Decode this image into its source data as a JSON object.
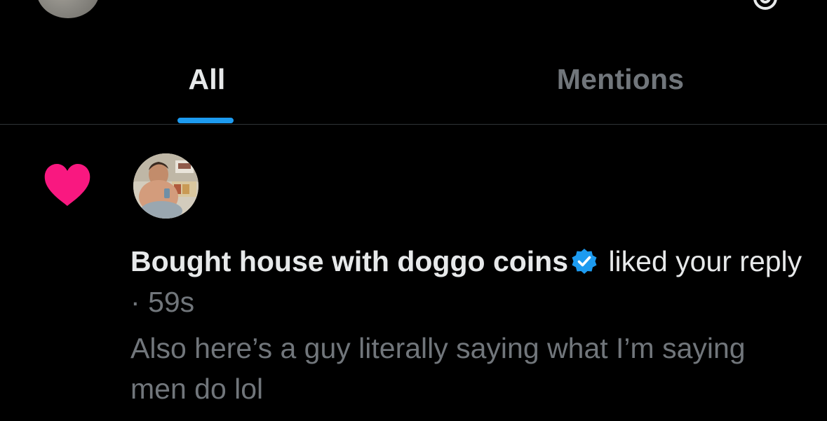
{
  "tabs": [
    {
      "label": "All",
      "active": true
    },
    {
      "label": "Mentions",
      "active": false
    }
  ],
  "notification": {
    "type_icon": "heart-icon",
    "user_name": "Bought house with doggo coins",
    "verified": true,
    "action": "liked your reply",
    "separator": "·",
    "time": "59s",
    "tweet_text": "Also here’s a guy literally saying what I’m saying men do lol"
  },
  "colors": {
    "background": "#000000",
    "accent": "#1d9bf0",
    "like": "#f91880",
    "primary_text": "#e7e9ea",
    "secondary_text": "#71767b",
    "divider": "#2f3336"
  }
}
